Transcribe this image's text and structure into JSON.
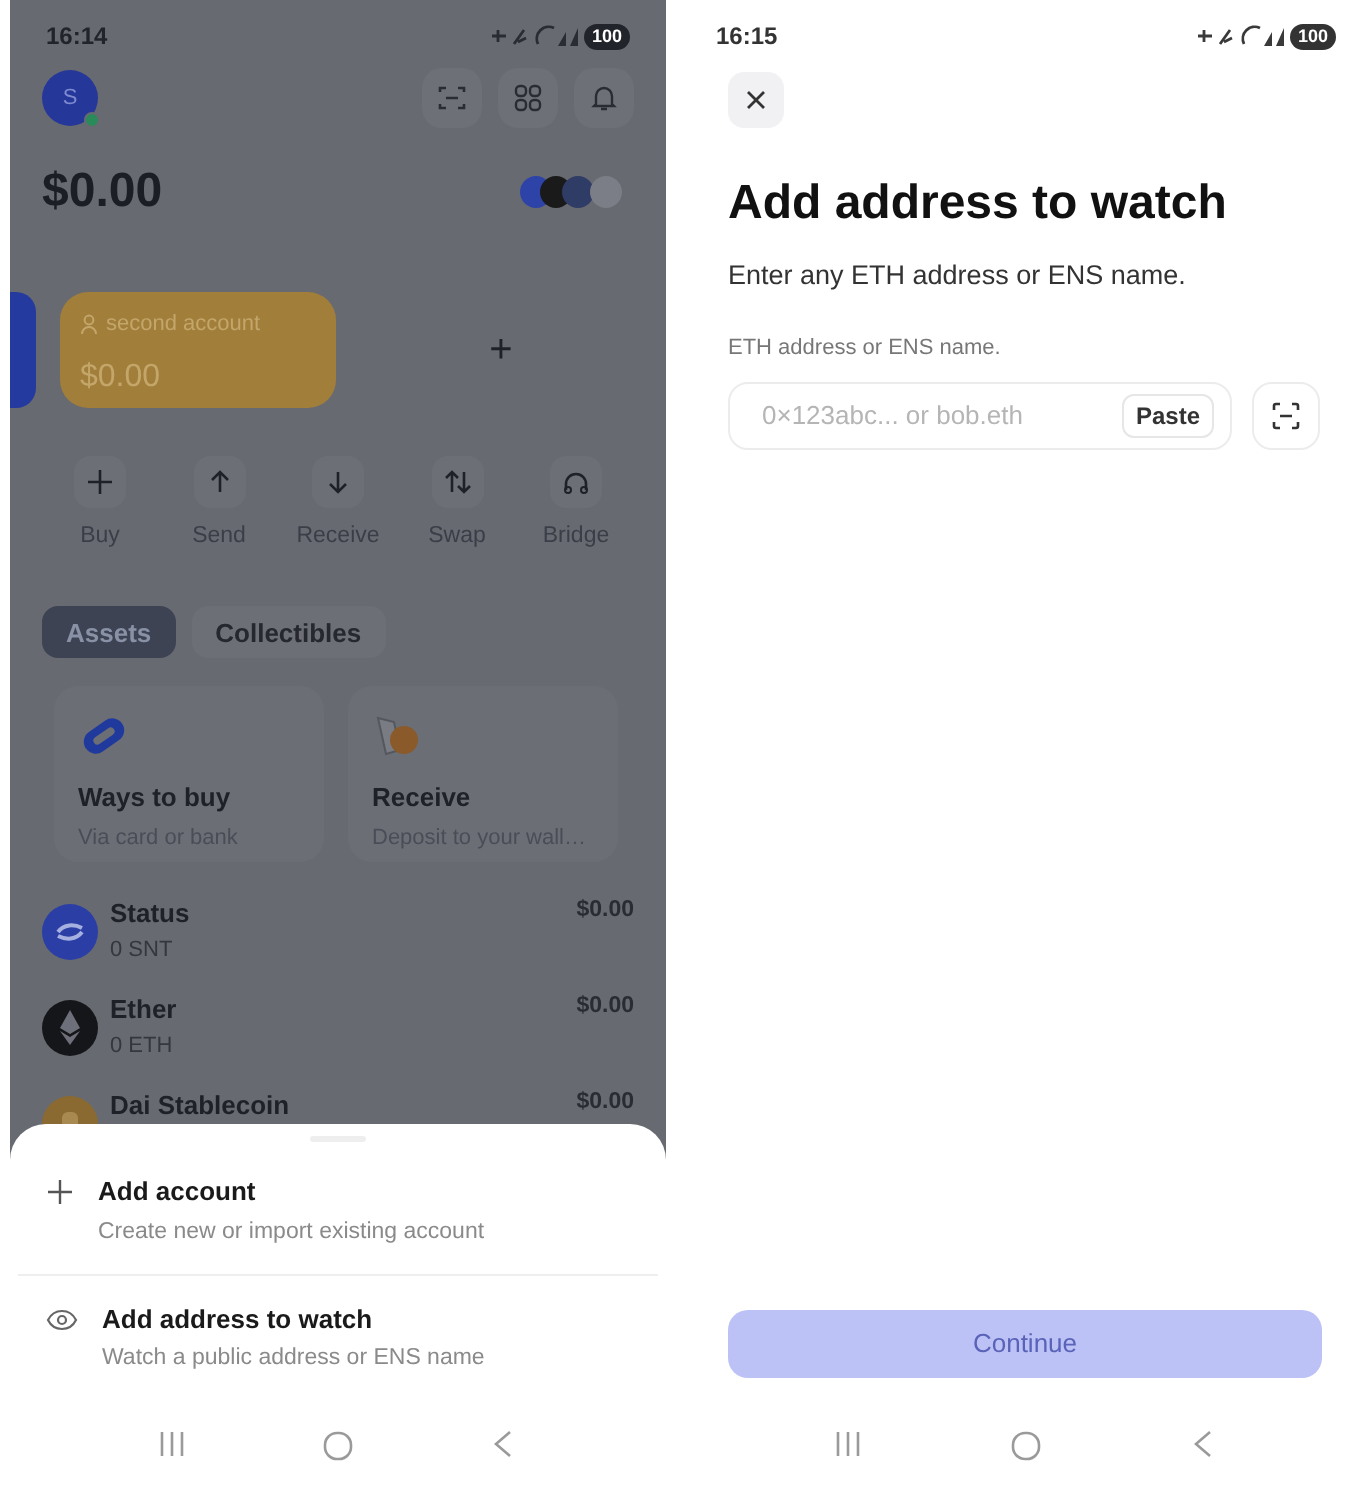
{
  "left_screen": {
    "status_bar": {
      "time": "16:14",
      "battery": "100"
    },
    "avatar": {
      "initial": "S"
    },
    "balance": "$0.00",
    "accounts": [
      {
        "name": "second account",
        "balance": "$0.00"
      }
    ],
    "add_account_symbol": "+",
    "actions": [
      {
        "label": "Buy",
        "kind": "plus"
      },
      {
        "label": "Send",
        "kind": "up"
      },
      {
        "label": "Receive",
        "kind": "down"
      },
      {
        "label": "Swap",
        "kind": "swap"
      },
      {
        "label": "Bridge",
        "kind": "bridge"
      }
    ],
    "tabs": [
      {
        "label": "Assets",
        "selected": true
      },
      {
        "label": "Collectibles",
        "selected": false
      }
    ],
    "promo_cards": [
      {
        "title": "Ways to buy",
        "subtitle": "Via card or bank",
        "kind": "link"
      },
      {
        "title": "Receive",
        "subtitle": "Deposit to your wall…",
        "kind": "hand"
      }
    ],
    "assets": [
      {
        "name": "Status",
        "amount": "0 SNT",
        "value": "$0.00",
        "kind": "status"
      },
      {
        "name": "Ether",
        "amount": "0 ETH",
        "value": "$0.00",
        "kind": "eth"
      },
      {
        "name": "Dai Stablecoin",
        "value": "$0.00",
        "kind": "dai"
      }
    ],
    "sheet": {
      "items": [
        {
          "kind": "plus",
          "title": "Add account",
          "subtitle": "Create new or import existing account"
        },
        {
          "kind": "eye",
          "title": "Add address to watch",
          "subtitle": "Watch a public address or ENS name"
        }
      ]
    }
  },
  "right_screen": {
    "status_bar": {
      "time": "16:15",
      "battery": "100"
    },
    "title": "Add address to watch",
    "subtitle": "Enter any ETH address or ENS name.",
    "field_label": "ETH address or ENS name.",
    "address_field": {
      "placeholder": "0×123abc... or bob.eth"
    },
    "paste_button": "Paste",
    "continue_button": {
      "label": "Continue",
      "disabled": true
    }
  }
}
